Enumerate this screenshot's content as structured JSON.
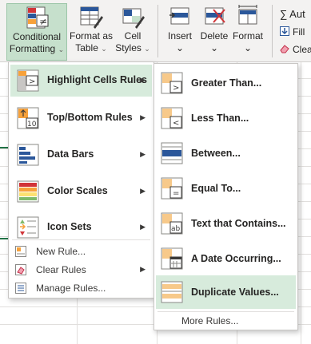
{
  "ribbon": {
    "conditional_formatting": {
      "line1": "Conditional",
      "line2": "Formatting",
      "chevron": "⌄"
    },
    "format_as_table": {
      "line1": "Format as",
      "line2": "Table",
      "chevron": "⌄"
    },
    "cell_styles": {
      "line1": "Cell",
      "line2": "Styles",
      "chevron": "⌄"
    },
    "insert": {
      "label": "Insert",
      "chevron": "⌄"
    },
    "delete": {
      "label": "Delete",
      "chevron": "⌄"
    },
    "format": {
      "label": "Format",
      "chevron": "⌄"
    },
    "autosum": {
      "label": "∑ Aut",
      "icon": "sum-icon"
    },
    "fill": {
      "label": "Fill",
      "icon": "fill-down-icon"
    },
    "clear": {
      "label": "Clea",
      "icon": "eraser-icon"
    }
  },
  "cf_menu": {
    "items": [
      {
        "label": "Highlight Cells Rules",
        "icon": "highlight-cells-icon",
        "has_submenu": true,
        "active": true
      },
      {
        "label": "Top/Bottom Rules",
        "icon": "top-bottom-icon",
        "has_submenu": true
      },
      {
        "label": "Data Bars",
        "icon": "data-bars-icon",
        "has_submenu": true
      },
      {
        "label": "Color Scales",
        "icon": "color-scales-icon",
        "has_submenu": true
      },
      {
        "label": "Icon Sets",
        "icon": "icon-sets-icon",
        "has_submenu": true
      }
    ],
    "small_items": [
      {
        "label": "New Rule...",
        "icon": "new-rule-icon"
      },
      {
        "label": "Clear Rules",
        "icon": "clear-rules-icon",
        "has_submenu": true
      },
      {
        "label": "Manage Rules...",
        "icon": "manage-rules-icon"
      }
    ]
  },
  "hl_menu": {
    "items": [
      {
        "label": "Greater Than...",
        "icon": "greater-than-icon"
      },
      {
        "label": "Less Than...",
        "icon": "less-than-icon"
      },
      {
        "label": "Between...",
        "icon": "between-icon"
      },
      {
        "label": "Equal To...",
        "icon": "equal-to-icon"
      },
      {
        "label": "Text that Contains...",
        "icon": "text-contains-icon"
      },
      {
        "label": "A Date Occurring...",
        "icon": "date-occurring-icon"
      },
      {
        "label": "Duplicate Values...",
        "icon": "duplicate-values-icon",
        "active": true
      }
    ],
    "more_rules": "More Rules..."
  },
  "colors": {
    "active_bg": "#d7ebdc",
    "cf_button_bg": "#c6e0cc",
    "accent_green": "#217346",
    "icon_blue": "#2b579a",
    "icon_red": "#d13438",
    "icon_orange": "#f7a13a"
  }
}
